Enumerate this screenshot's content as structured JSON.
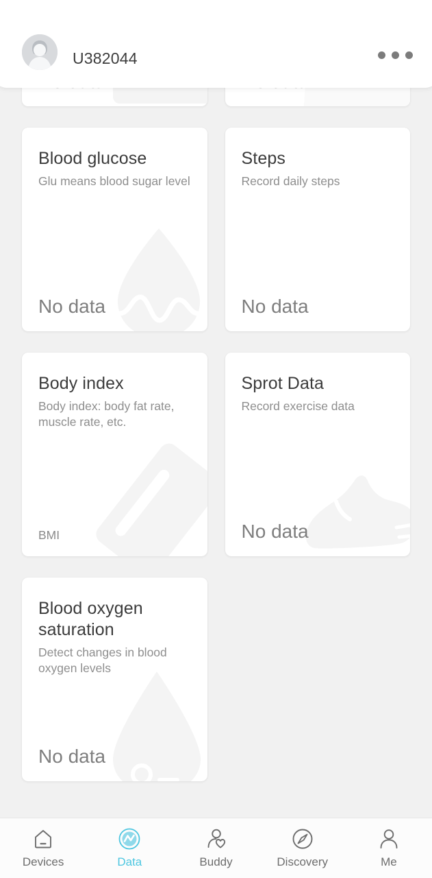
{
  "header": {
    "username": "U382044",
    "avatar_icon": "person-avatar-icon",
    "more_icon": "more-options-icon",
    "more_label": "•••"
  },
  "theme": {
    "background": "#f1f1f1",
    "card_background": "#ffffff",
    "accent": "#4cc6e0",
    "title_text": "#3b3b3b",
    "subtitle_text": "#8e8e8e",
    "value_text": "#7e7e7e",
    "nav_inactive": "#6d6d6d"
  },
  "cards": [
    {
      "title": "",
      "subtitle": "",
      "value": "No data",
      "watermark": "rectangle-device-icon",
      "clipped": true
    },
    {
      "title": "",
      "subtitle": "",
      "value": "No data",
      "watermark": "blank-icon",
      "clipped": true
    },
    {
      "title": "Blood glucose",
      "subtitle": "Glu means blood sugar level",
      "value": "No data",
      "watermark": "blood-drop-wave-icon",
      "clipped": false
    },
    {
      "title": "Steps",
      "subtitle": "Record daily steps",
      "value": "No data",
      "watermark": "none",
      "clipped": false
    },
    {
      "title": "Body index",
      "subtitle": "Body index: body fat rate, muscle rate, etc.",
      "value": "BMI",
      "watermark": "body-scale-ruler-icon",
      "clipped": false
    },
    {
      "title": "Sprot Data",
      "subtitle": "Record exercise data",
      "value": "No data",
      "watermark": "running-shoe-icon",
      "clipped": false
    },
    {
      "title": "Blood oxygen saturation",
      "subtitle": "Detect changes in blood oxygen levels",
      "value": "No data",
      "watermark": "oxygen-drop-icon",
      "clipped": false
    }
  ],
  "bottom_nav": {
    "active_index": 1,
    "items": [
      {
        "label": "Devices",
        "icon": "home-device-icon"
      },
      {
        "label": "Data",
        "icon": "data-pulse-icon"
      },
      {
        "label": "Buddy",
        "icon": "person-heart-icon"
      },
      {
        "label": "Discovery",
        "icon": "compass-icon"
      },
      {
        "label": "Me",
        "icon": "person-icon"
      }
    ]
  }
}
